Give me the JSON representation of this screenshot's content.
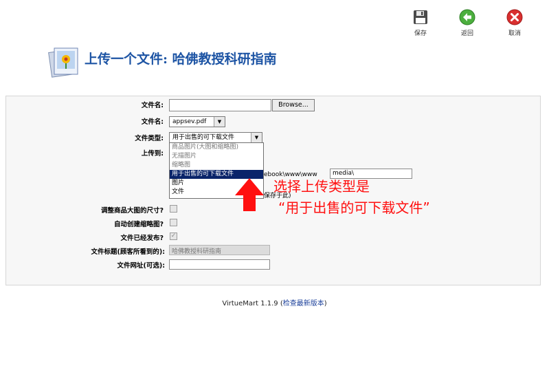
{
  "toolbar": {
    "save": "保存",
    "back": "返回",
    "cancel": "取消"
  },
  "header": {
    "title": "上传一个文件: 哈佛教授科研指南"
  },
  "form": {
    "filename_label": "文件名:",
    "browse_button": "Browse...",
    "filename2_label": "文件名:",
    "filename2_value": "appsev.pdf",
    "filetype_label": "文件类型:",
    "filetype_value": "用于出售的可下载文件",
    "upload_to_label": "上传到:",
    "path_partial": "ebook\\www\\www",
    "path_value": "media\\",
    "save_hint": "保存于此)",
    "resize_label": "调整商品大图的尺寸?",
    "thumb_label": "自动创建缩略图?",
    "published_label": "文件已经发布?",
    "published_check": "✓",
    "file_title_label": "文件标题(顾客所看到的):",
    "file_title_value": "哈佛教授科研指南",
    "file_url_label": "文件网址(可选):"
  },
  "dropdown": {
    "options": [
      "商品图片(大图和缩略图)",
      "无描图片",
      "缩略图",
      "用于出售的可下载文件",
      "图片",
      "文件"
    ],
    "selected_index": 3
  },
  "annotation": {
    "line1": "选择上传类型是",
    "line2": "“用于出售的可下载文件”",
    "color": "#ff1010"
  },
  "footer": {
    "version": "VirtueMart 1.1.9 (",
    "link": "检查最新版本",
    "close": ")"
  },
  "colors": {
    "title": "#1d54a4",
    "highlight": "#0a246a"
  }
}
